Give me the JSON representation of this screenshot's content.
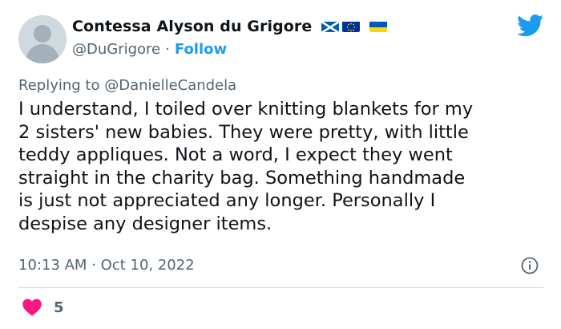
{
  "author": {
    "display_name": "Contessa Alyson du Grigore",
    "handle": "@DuGrigore",
    "separator": "·",
    "follow_label": "Follow",
    "flags": [
      "scotland-flag-icon",
      "eu-flag-icon",
      "ukraine-flag-icon"
    ]
  },
  "reply": {
    "prefix": "Replying to",
    "to": "@DanielleCandela"
  },
  "tweet": {
    "lines": [
      "I understand, I toiled over knitting blankets for my",
      "2 sisters' new babies. They were pretty, with little",
      "teddy appliques. Not a word, I expect they went",
      "straight in the charity bag. Something handmade",
      "is just not appreciated any longer. Personally I",
      "despise any designer items."
    ],
    "time": "10:13 AM",
    "date_separator": "·",
    "date": "Oct 10, 2022"
  },
  "engagement": {
    "likes": "5",
    "icon": "heart-icon"
  },
  "colors": {
    "accent": "#1d9bf0",
    "like": "#f91880",
    "secondary_text": "#536471"
  }
}
